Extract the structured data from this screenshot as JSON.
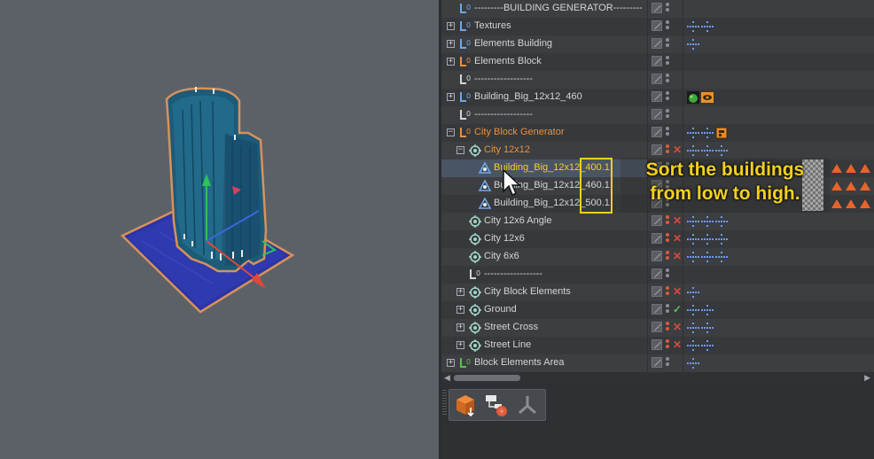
{
  "annotation": {
    "line1": "Sort the buildings",
    "line2": "from low to high."
  },
  "object_manager": {
    "rows": [
      {
        "name": "---------BUILDING GENERATOR---------",
        "icon": "null-object-icon",
        "icon_color": "#6fa7e6",
        "indent": 0,
        "expander": "",
        "name_color": "default",
        "status": "",
        "tags": []
      },
      {
        "name": "Textures",
        "icon": "null-object-icon",
        "icon_color": "#6fa7e6",
        "indent": 0,
        "expander": "+",
        "name_color": "default",
        "status": "",
        "tags": [
          "constraint-tag-icon",
          "constraint-tag-icon"
        ]
      },
      {
        "name": "Elements Building",
        "icon": "null-object-icon",
        "icon_color": "#6fa7e6",
        "indent": 0,
        "expander": "+",
        "name_color": "default",
        "status": "",
        "tags": [
          "constraint-tag-icon"
        ]
      },
      {
        "name": "Elements Block",
        "icon": "null-object-icon",
        "icon_color": "#e8923e",
        "indent": 0,
        "expander": "+",
        "name_color": "default",
        "status": "",
        "tags": []
      },
      {
        "name": "------------------",
        "icon": "null-object-icon",
        "icon_color": "#d2d5d8",
        "indent": 0,
        "expander": "",
        "name_color": "default",
        "status": "",
        "tags": []
      },
      {
        "name": "Building_Big_12x12_460",
        "icon": "null-object-icon",
        "icon_color": "#6fa7e6",
        "indent": 0,
        "expander": "+",
        "name_color": "default",
        "status": "",
        "tags": [
          "green-sphere-tag-icon",
          "eye-tag-icon"
        ]
      },
      {
        "name": "------------------",
        "icon": "null-object-icon",
        "icon_color": "#d2d5d8",
        "indent": 0,
        "expander": "",
        "name_color": "default",
        "status": "",
        "tags": []
      },
      {
        "name": "City Block Generator",
        "icon": "null-object-icon",
        "icon_color": "#e8923e",
        "indent": 0,
        "expander": "-",
        "name_color": "orange",
        "status": "",
        "tags": [
          "constraint-tag-icon",
          "constraint-tag-icon",
          "xpresso-tag-icon"
        ]
      },
      {
        "name": "City 12x12",
        "icon": "cloner-icon",
        "icon_color": "#9fd6c8",
        "indent": 1,
        "expander": "-",
        "name_color": "orange",
        "status": "x",
        "tags": [
          "constraint-tag-icon",
          "constraint-tag-icon",
          "constraint-tag-icon"
        ]
      },
      {
        "name": "Building_Big_12x12_400.1",
        "icon": "instance-icon",
        "icon_color": "#6fa7e6",
        "indent": 2,
        "expander": "",
        "name_color": "yellow",
        "status": "",
        "tags": []
      },
      {
        "name": "Building_Big_12x12_460.1",
        "icon": "instance-icon",
        "icon_color": "#6fa7e6",
        "indent": 2,
        "expander": "",
        "name_color": "default",
        "status": "",
        "tags": []
      },
      {
        "name": "Building_Big_12x12_500.1",
        "icon": "instance-icon",
        "icon_color": "#6fa7e6",
        "indent": 2,
        "expander": "",
        "name_color": "default",
        "status": "",
        "tags": []
      },
      {
        "name": "City 12x6 Angle",
        "icon": "cloner-icon",
        "icon_color": "#9fd6c8",
        "indent": 1,
        "expander": "",
        "name_color": "default",
        "status": "x",
        "tags": [
          "constraint-tag-icon",
          "constraint-tag-icon",
          "constraint-tag-icon"
        ]
      },
      {
        "name": "City 12x6",
        "icon": "cloner-icon",
        "icon_color": "#9fd6c8",
        "indent": 1,
        "expander": "",
        "name_color": "default",
        "status": "x",
        "tags": [
          "constraint-tag-icon",
          "constraint-tag-icon",
          "constraint-tag-icon"
        ]
      },
      {
        "name": "City 6x6",
        "icon": "cloner-icon",
        "icon_color": "#9fd6c8",
        "indent": 1,
        "expander": "",
        "name_color": "default",
        "status": "x",
        "tags": [
          "constraint-tag-icon",
          "constraint-tag-icon",
          "constraint-tag-icon"
        ]
      },
      {
        "name": "------------------",
        "icon": "null-object-icon",
        "icon_color": "#d2d5d8",
        "indent": 1,
        "expander": "",
        "name_color": "default",
        "status": "",
        "tags": []
      },
      {
        "name": "City Block Elements",
        "icon": "cloner-icon",
        "icon_color": "#9fd6c8",
        "indent": 1,
        "expander": "+",
        "name_color": "default",
        "status": "x",
        "tags": [
          "constraint-tag-icon"
        ]
      },
      {
        "name": "Ground",
        "icon": "cloner-icon",
        "icon_color": "#9fd6c8",
        "indent": 1,
        "expander": "+",
        "name_color": "default",
        "status": "check",
        "tags": [
          "constraint-tag-icon",
          "constraint-tag-icon"
        ]
      },
      {
        "name": "Street Cross",
        "icon": "cloner-icon",
        "icon_color": "#9fd6c8",
        "indent": 1,
        "expander": "+",
        "name_color": "default",
        "status": "x",
        "tags": [
          "constraint-tag-icon",
          "constraint-tag-icon"
        ]
      },
      {
        "name": "Street Line",
        "icon": "cloner-icon",
        "icon_color": "#9fd6c8",
        "indent": 1,
        "expander": "+",
        "name_color": "default",
        "status": "x",
        "tags": [
          "constraint-tag-icon",
          "constraint-tag-icon"
        ]
      },
      {
        "name": "Block Elements Area",
        "icon": "null-object-icon",
        "icon_color": "#5cc04e",
        "indent": 0,
        "expander": "+",
        "name_color": "default",
        "status": "",
        "tags": [
          "constraint-tag-icon"
        ]
      }
    ],
    "selected_row": 9,
    "highlight_rows": [
      9,
      10,
      11
    ]
  },
  "toolbar": {
    "buttons": [
      {
        "name": "object-tool-icon"
      },
      {
        "name": "hierarchy-tool-icon"
      },
      {
        "name": "joint-tool-icon"
      }
    ]
  },
  "colors": {
    "accent_yellow": "#f5d020",
    "orange_label": "#e8923e",
    "building_teal": "#1e5a78",
    "ground_blue": "#2a36a8"
  }
}
